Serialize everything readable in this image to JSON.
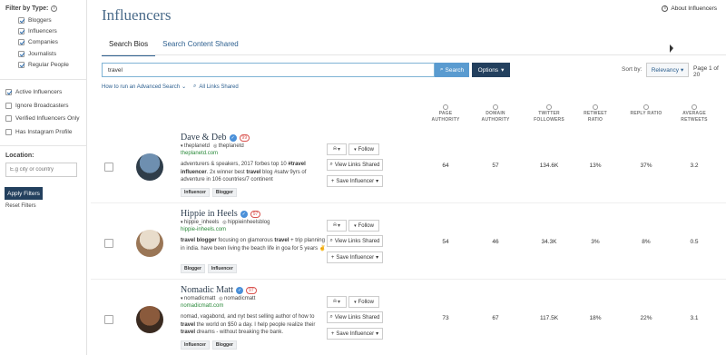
{
  "sidebar": {
    "filter_title": "Filter by Type:",
    "types": [
      {
        "label": "Bloggers",
        "checked": true
      },
      {
        "label": "Influencers",
        "checked": true
      },
      {
        "label": "Companies",
        "checked": true
      },
      {
        "label": "Journalists",
        "checked": true
      },
      {
        "label": "Regular People",
        "checked": true
      }
    ],
    "options": [
      {
        "label": "Active Influencers",
        "checked": true
      },
      {
        "label": "Ignore Broadcasters",
        "checked": false
      },
      {
        "label": "Verified Influencers Only",
        "checked": false
      },
      {
        "label": "Has Instagram Profile",
        "checked": false
      }
    ],
    "location_label": "Location:",
    "location_placeholder": "E.g city or country",
    "apply_label": "Apply Filters",
    "reset_label": "Reset Filters"
  },
  "header": {
    "title": "Influencers",
    "about_link": "About Influencers",
    "tabs": [
      {
        "label": "Search Bios",
        "active": true
      },
      {
        "label": "Search Content Shared",
        "active": false
      }
    ]
  },
  "search": {
    "query": "travel",
    "button_label": "Search",
    "options_label": "Options",
    "sort_by_label": "Sort by:",
    "sort_value": "Relevancy",
    "page_info": "Page 1 of 20",
    "advanced_link": "How to run an Advanced Search",
    "all_links_label": "All Links Shared"
  },
  "columns": [
    {
      "line1": "PAGE",
      "line2": "AUTHORITY"
    },
    {
      "line1": "DOMAIN",
      "line2": "AUTHORITY"
    },
    {
      "line1": "TWITTER",
      "line2": "FOLLOWERS"
    },
    {
      "line1": "RETWEET",
      "line2": "RATIO"
    },
    {
      "line1": "REPLY RATIO",
      "line2": ""
    },
    {
      "line1": "AVERAGE",
      "line2": "RETWEETS"
    }
  ],
  "actions": {
    "follow": "Follow",
    "view_links": "View Links Shared",
    "save": "Save Influencer"
  },
  "results": [
    {
      "name": "Dave & Deb",
      "score": "99",
      "twitter": "theplanetd",
      "instagram": "theplanetd",
      "site": "theplanetd.com",
      "bio_parts": [
        {
          "t": "adventurers & speakers, 2017 forbes top 10 ",
          "b": false
        },
        {
          "t": "#travel influencer",
          "b": true
        },
        {
          "t": ". 2x winner best ",
          "b": false
        },
        {
          "t": "travel",
          "b": true
        },
        {
          "t": " blog #satw 9yrs of adventure in 106 countries/7 continent",
          "b": false
        }
      ],
      "tags": [
        "Influencer",
        "Blogger"
      ],
      "metrics": [
        "64",
        "57",
        "134.6K",
        "13%",
        "37%",
        "3.2"
      ],
      "avatar_colors": [
        "#6e8fb0",
        "#2f3d4a"
      ]
    },
    {
      "name": "Hippie in Heels",
      "score": "97",
      "twitter": "hippie_inheels",
      "instagram": "hippieinheelsblog",
      "site": "hippie-inheels.com",
      "bio_parts": [
        {
          "t": "travel blogger",
          "b": true
        },
        {
          "t": " focusing on glamorous ",
          "b": false
        },
        {
          "t": "travel",
          "b": true
        },
        {
          "t": " + trip planning in india. have been living the beach life in goa for 5 years ✌",
          "b": false
        }
      ],
      "tags": [
        "Blogger",
        "Influencer"
      ],
      "metrics": [
        "54",
        "46",
        "34.3K",
        "3%",
        "8%",
        "0.5"
      ],
      "avatar_colors": [
        "#e8dccb",
        "#9a7656"
      ]
    },
    {
      "name": "Nomadic Matt",
      "score": "97",
      "twitter": "nomadicmatt",
      "instagram": "nomadicmatt",
      "site": "nomadicmatt.com",
      "bio_parts": [
        {
          "t": "nomad, vagabond, and nyt best selling author of how to ",
          "b": false
        },
        {
          "t": "travel",
          "b": true
        },
        {
          "t": " the world on $50 a day. I help people realize their ",
          "b": false
        },
        {
          "t": "travel",
          "b": true
        },
        {
          "t": " dreams - without breaking the bank.",
          "b": false
        }
      ],
      "tags": [
        "Influencer",
        "Blogger"
      ],
      "metrics": [
        "73",
        "67",
        "117.5K",
        "18%",
        "22%",
        "3.1"
      ],
      "avatar_colors": [
        "#8a5a3c",
        "#3a2a20"
      ]
    }
  ]
}
